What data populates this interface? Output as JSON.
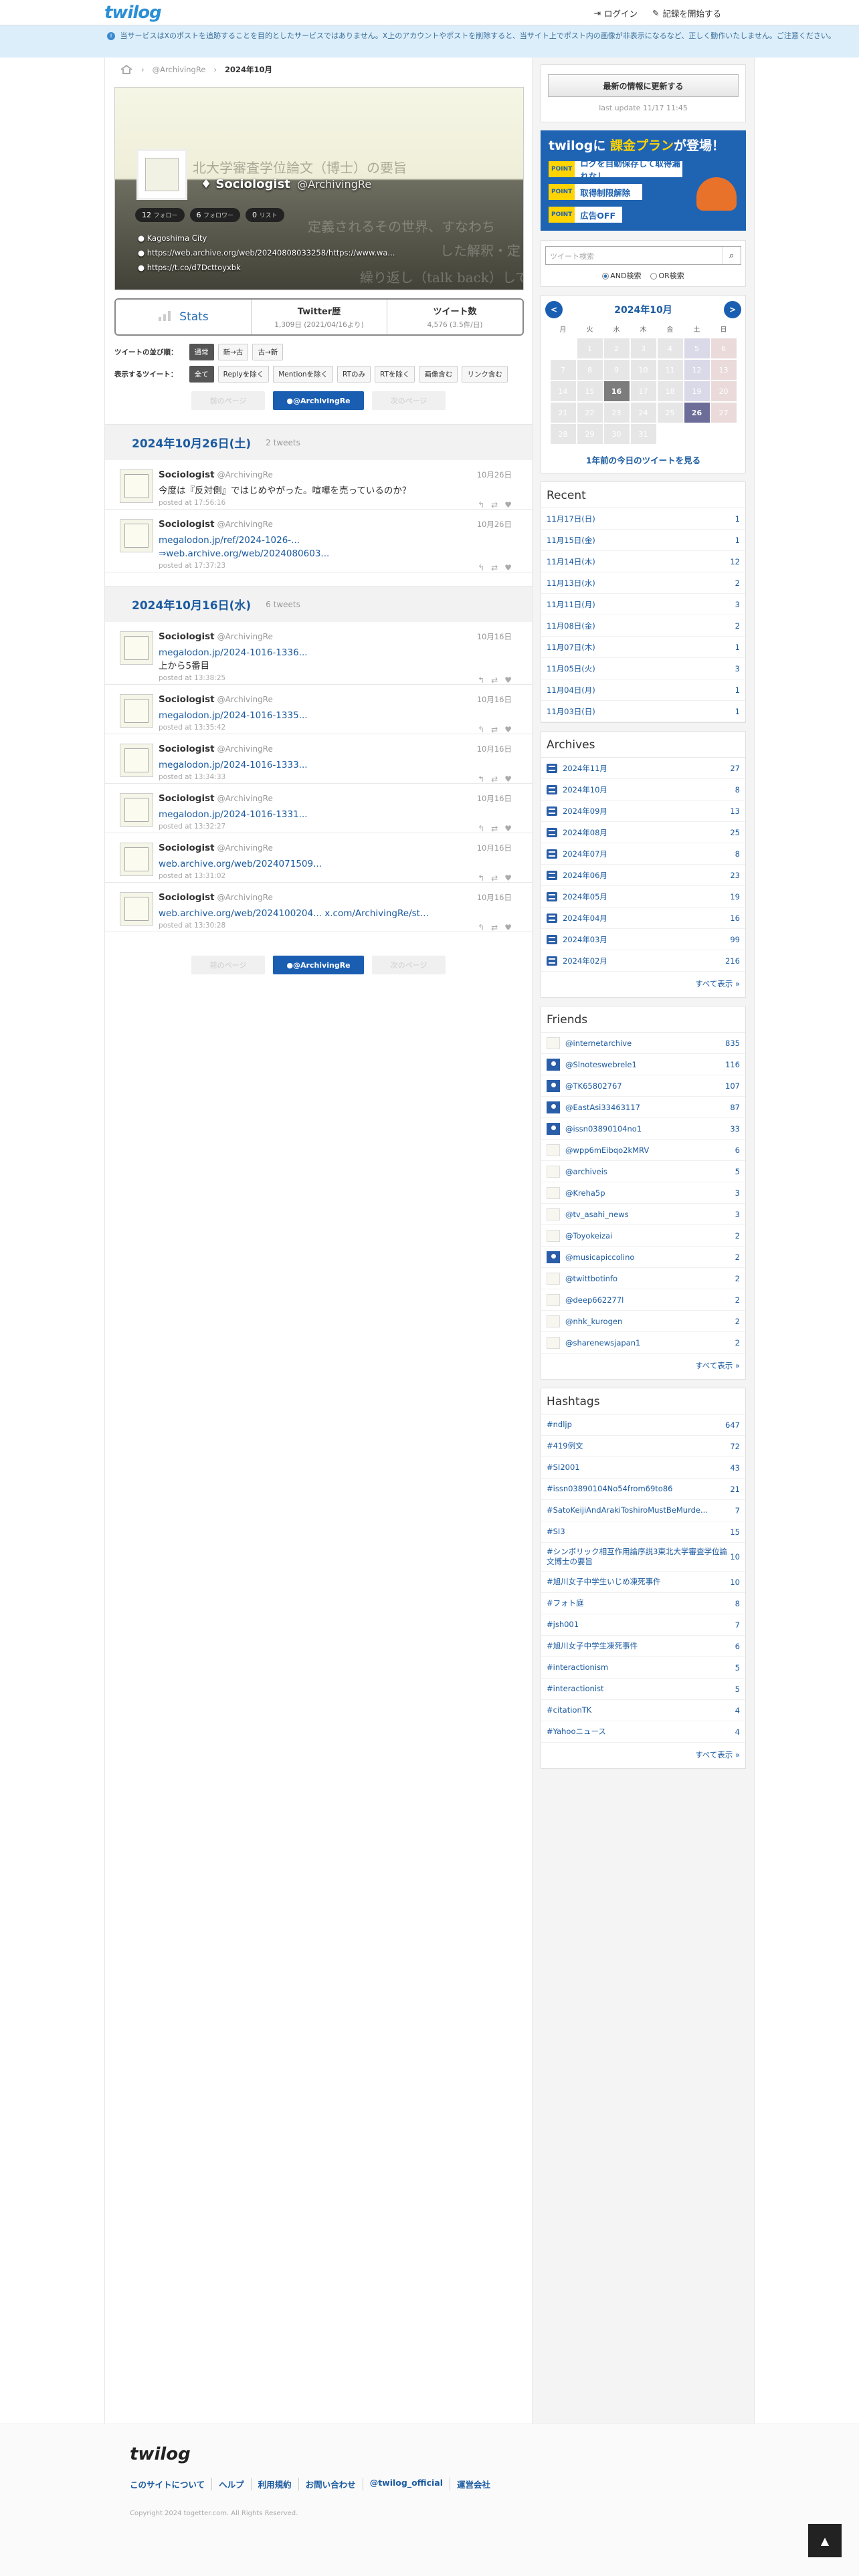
{
  "header": {
    "logo": "twilog",
    "login": "ログイン",
    "start": "記録を開始する"
  },
  "notice": "当サービスはXのポストを追跡することを目的としたサービスではありません。X上のアカウントやポストを削除すると、当サイト上でポスト内の画像が非表示になるなど、正しく動作いたしません。ご注意ください。",
  "breadcrumb": {
    "user": "@ArchivingRe",
    "current": "2024年10月"
  },
  "profile": {
    "bg_line1": "北大学審査学位論文（博士）の要旨",
    "bg_line2": "定義されるその世界、すなわち",
    "bg_line3": "した解釈・定",
    "bg_line4": "繰り返し（talk back）してくる",
    "name": "Sociologist",
    "handle": "@ArchivingRe",
    "follow_count": "12",
    "follow_label": "フォロー",
    "follower_count": "6",
    "follower_label": "フォロワー",
    "list_count": "0",
    "list_label": "リスト",
    "location": "Kagoshima City",
    "link1": "https://web.archive.org/web/20240808033258/https://www.wa...",
    "link2": "https://t.co/d7Dcttoyxbk"
  },
  "stats": {
    "title": "Stats",
    "history_label": "Twitter歴",
    "history_value": "1,309日",
    "history_sub": "(2021/04/16より)",
    "tweets_label": "ツイート数",
    "tweets_value": "4,576",
    "tweets_sub": "(3.5件/日)"
  },
  "filters": {
    "order_label": "ツイートの並び順：",
    "order": [
      "通常",
      "新→古",
      "古→新"
    ],
    "show_label": "表示するツイート：",
    "show": [
      "全て",
      "Replyを除く",
      "Mentionを除く",
      "RTのみ",
      "RTを除く",
      "画像含む",
      "リンク含む"
    ]
  },
  "pager": {
    "prev": "前のページ",
    "user": "@ArchivingRe",
    "next": "次のページ"
  },
  "days": [
    {
      "date": "2024年10月26日(土)",
      "count": "2 tweets",
      "tweets": [
        {
          "name": "Sociologist",
          "handle": "@ArchivingRe",
          "date": "10月26日",
          "lines": [
            "今度は『反対側』ではじめやがった。喧嘩を売っているのか？"
          ],
          "posted": "posted at 17:56:16"
        },
        {
          "name": "Sociologist",
          "handle": "@ArchivingRe",
          "date": "10月26日",
          "lines": [
            "megalodon.jp/ref/2024-1026-...",
            "⇒web.archive.org/web/2024080603..."
          ],
          "posted": "posted at 17:37:23"
        }
      ]
    },
    {
      "date": "2024年10月16日(水)",
      "count": "6 tweets",
      "tweets": [
        {
          "name": "Sociologist",
          "handle": "@ArchivingRe",
          "date": "10月16日",
          "lines": [
            "megalodon.jp/2024-1016-1336...",
            "上から5番目"
          ],
          "posted": "posted at 13:38:25"
        },
        {
          "name": "Sociologist",
          "handle": "@ArchivingRe",
          "date": "10月16日",
          "lines": [
            "megalodon.jp/2024-1016-1335..."
          ],
          "posted": "posted at 13:35:42"
        },
        {
          "name": "Sociologist",
          "handle": "@ArchivingRe",
          "date": "10月16日",
          "lines": [
            "megalodon.jp/2024-1016-1333..."
          ],
          "posted": "posted at 13:34:33"
        },
        {
          "name": "Sociologist",
          "handle": "@ArchivingRe",
          "date": "10月16日",
          "lines": [
            "megalodon.jp/2024-1016-1331..."
          ],
          "posted": "posted at 13:32:27"
        },
        {
          "name": "Sociologist",
          "handle": "@ArchivingRe",
          "date": "10月16日",
          "lines": [
            "web.archive.org/web/2024071509..."
          ],
          "posted": "posted at 13:31:02"
        },
        {
          "name": "Sociologist",
          "handle": "@ArchivingRe",
          "date": "10月16日",
          "lines": [
            "web.archive.org/web/2024100204... x.com/ArchivingRe/st..."
          ],
          "posted": "posted at 13:30:28"
        }
      ]
    }
  ],
  "sidebar": {
    "update_button": "最新の情報に更新する",
    "last_update": "last update 11/17 11:45",
    "ad": {
      "headline_a": "twilog",
      "headline_b": "に",
      "headline_c": "課金プラン",
      "headline_d": "が登場！",
      "tag": "POINT",
      "rows": [
        "ログを自動保存して取得漏れなし",
        "取得制限解除",
        "広告OFF"
      ]
    },
    "search_placeholder": "ツイート検索",
    "search_and": "AND検索",
    "search_or": "OR検索",
    "calendar": {
      "title": "2024年10月",
      "prev": "<",
      "next": ">",
      "dow": [
        "月",
        "火",
        "水",
        "木",
        "金",
        "土",
        "日"
      ],
      "weeks": [
        [
          "",
          "1",
          "2",
          "3",
          "4",
          "5",
          "6"
        ],
        [
          "7",
          "8",
          "9",
          "10",
          "11",
          "12",
          "13"
        ],
        [
          "14",
          "15",
          "16",
          "17",
          "18",
          "19",
          "20"
        ],
        [
          "21",
          "22",
          "23",
          "24",
          "25",
          "26",
          "27"
        ],
        [
          "28",
          "29",
          "30",
          "31",
          "",
          "",
          ""
        ]
      ],
      "active_days": [
        "16",
        "26"
      ],
      "link": "1年前の今日のツイートを見る"
    },
    "recent_title": "Recent",
    "recent": [
      {
        "label": "11月17日(日)",
        "n": "1"
      },
      {
        "label": "11月15日(金)",
        "n": "1"
      },
      {
        "label": "11月14日(木)",
        "n": "12"
      },
      {
        "label": "11月13日(水)",
        "n": "2"
      },
      {
        "label": "11月11日(月)",
        "n": "3"
      },
      {
        "label": "11月08日(金)",
        "n": "2"
      },
      {
        "label": "11月07日(木)",
        "n": "1"
      },
      {
        "label": "11月05日(火)",
        "n": "3"
      },
      {
        "label": "11月04日(月)",
        "n": "1"
      },
      {
        "label": "11月03日(日)",
        "n": "1"
      }
    ],
    "archives_title": "Archives",
    "archives": [
      {
        "label": "2024年11月",
        "n": "27"
      },
      {
        "label": "2024年10月",
        "n": "8"
      },
      {
        "label": "2024年09月",
        "n": "13"
      },
      {
        "label": "2024年08月",
        "n": "25"
      },
      {
        "label": "2024年07月",
        "n": "8"
      },
      {
        "label": "2024年06月",
        "n": "23"
      },
      {
        "label": "2024年05月",
        "n": "19"
      },
      {
        "label": "2024年04月",
        "n": "16"
      },
      {
        "label": "2024年03月",
        "n": "99"
      },
      {
        "label": "2024年02月",
        "n": "216"
      }
    ],
    "archives_more": "すべて表示 »",
    "friends_title": "Friends",
    "friends": [
      {
        "label": "@internetarchive",
        "n": "835",
        "blue": false
      },
      {
        "label": "@Slnoteswebrele1",
        "n": "116",
        "blue": true
      },
      {
        "label": "@TK65802767",
        "n": "107",
        "blue": true
      },
      {
        "label": "@EastAsi33463117",
        "n": "87",
        "blue": true
      },
      {
        "label": "@issn03890104no1",
        "n": "33",
        "blue": true
      },
      {
        "label": "@wpp6mEibqo2kMRV",
        "n": "6",
        "blue": false
      },
      {
        "label": "@archiveis",
        "n": "5",
        "blue": false
      },
      {
        "label": "@Kreha5p",
        "n": "3",
        "blue": false
      },
      {
        "label": "@tv_asahi_news",
        "n": "3",
        "blue": false
      },
      {
        "label": "@Toyokeizai",
        "n": "2",
        "blue": false
      },
      {
        "label": "@musicapiccolino",
        "n": "2",
        "blue": true
      },
      {
        "label": "@twittbotinfo",
        "n": "2",
        "blue": false
      },
      {
        "label": "@deep662277l",
        "n": "2",
        "blue": false
      },
      {
        "label": "@nhk_kurogen",
        "n": "2",
        "blue": false
      },
      {
        "label": "@sharenewsjapan1",
        "n": "2",
        "blue": false
      }
    ],
    "friends_more": "すべて表示 »",
    "hashtags_title": "Hashtags",
    "hashtags": [
      {
        "label": "#ndljp",
        "n": "647"
      },
      {
        "label": "#419例文",
        "n": "72"
      },
      {
        "label": "#SI2001",
        "n": "43"
      },
      {
        "label": "#issn03890104No54from69to86",
        "n": "21"
      },
      {
        "label": "#SatoKeijiAndArakiToshiroMustBeMurde...",
        "n": "7"
      },
      {
        "label": "#SI3",
        "n": "15"
      },
      {
        "label": "#シンボリック相互作用論序説3東北大学審査学位論文博士の要旨",
        "n": "10"
      },
      {
        "label": "#旭川女子中学生いじめ凍死事件",
        "n": "10"
      },
      {
        "label": "#フォト庭",
        "n": "8"
      },
      {
        "label": "#jsh001",
        "n": "7"
      },
      {
        "label": "#旭川女子中学生凍死事件",
        "n": "6"
      },
      {
        "label": "#interactionism",
        "n": "5"
      },
      {
        "label": "#interactionist",
        "n": "5"
      },
      {
        "label": "#citationTK",
        "n": "4"
      },
      {
        "label": "#Yahooニュース",
        "n": "4"
      }
    ],
    "hashtags_more": "すべて表示 »"
  },
  "footer": {
    "logo": "twilog",
    "links": [
      "このサイトについて",
      "ヘルプ",
      "利用規約",
      "お問い合わせ",
      "@twilog_official",
      "運営会社"
    ],
    "copyright": "Copyright 2024 togetter.com. All Rights Reserved."
  }
}
